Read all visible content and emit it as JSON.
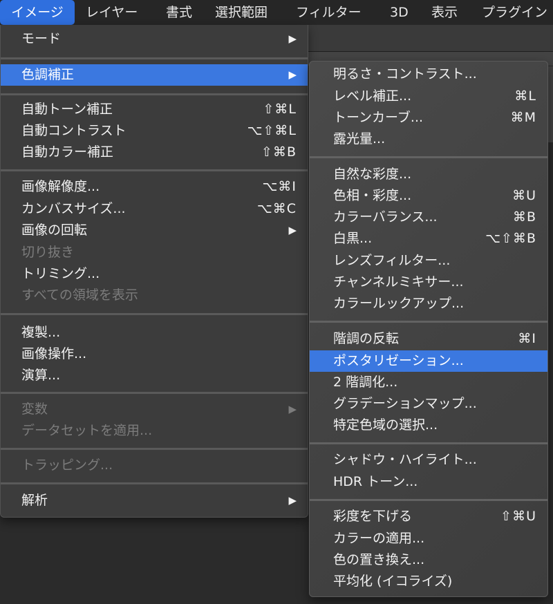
{
  "menubar": {
    "items": [
      "イメージ",
      "レイヤー",
      "書式",
      "選択範囲",
      "フィルター",
      "3D",
      "表示",
      "プラグイン"
    ],
    "active_index": 0
  },
  "image_menu": {
    "items": [
      {
        "label": "モード",
        "arrow": "▶"
      },
      {
        "label": "色調補正",
        "arrow": "▶"
      },
      {
        "label": "自動トーン補正",
        "shortcut": "⇧⌘L"
      },
      {
        "label": "自動コントラスト",
        "shortcut": "⌥⇧⌘L"
      },
      {
        "label": "自動カラー補正",
        "shortcut": "⇧⌘B"
      },
      {
        "label": "画像解像度...",
        "shortcut": "⌥⌘I"
      },
      {
        "label": "カンバスサイズ...",
        "shortcut": "⌥⌘C"
      },
      {
        "label": "画像の回転",
        "arrow": "▶"
      },
      {
        "label": "切り抜き"
      },
      {
        "label": "トリミング..."
      },
      {
        "label": "すべての領域を表示"
      },
      {
        "label": "複製..."
      },
      {
        "label": "画像操作..."
      },
      {
        "label": "演算..."
      },
      {
        "label": "変数",
        "arrow": "▶"
      },
      {
        "label": "データセットを適用..."
      },
      {
        "label": "トラッピング..."
      },
      {
        "label": "解析",
        "arrow": "▶"
      }
    ]
  },
  "adjustments_menu": {
    "items": [
      {
        "label": "明るさ・コントラスト..."
      },
      {
        "label": "レベル補正...",
        "shortcut": "⌘L"
      },
      {
        "label": "トーンカーブ...",
        "shortcut": "⌘M"
      },
      {
        "label": "露光量..."
      },
      {
        "label": "自然な彩度..."
      },
      {
        "label": "色相・彩度...",
        "shortcut": "⌘U"
      },
      {
        "label": "カラーバランス...",
        "shortcut": "⌘B"
      },
      {
        "label": "白黒...",
        "shortcut": "⌥⇧⌘B"
      },
      {
        "label": "レンズフィルター..."
      },
      {
        "label": "チャンネルミキサー..."
      },
      {
        "label": "カラールックアップ..."
      },
      {
        "label": "階調の反転",
        "shortcut": "⌘I"
      },
      {
        "label": "ポスタリゼーション..."
      },
      {
        "label": "2 階調化..."
      },
      {
        "label": "グラデーションマップ..."
      },
      {
        "label": "特定色域の選択..."
      },
      {
        "label": "シャドウ・ハイライト..."
      },
      {
        "label": "HDR トーン..."
      },
      {
        "label": "彩度を下げる",
        "shortcut": "⇧⌘U"
      },
      {
        "label": "カラーの適用..."
      },
      {
        "label": "色の置き換え..."
      },
      {
        "label": "平均化 (イコライズ)"
      }
    ]
  }
}
